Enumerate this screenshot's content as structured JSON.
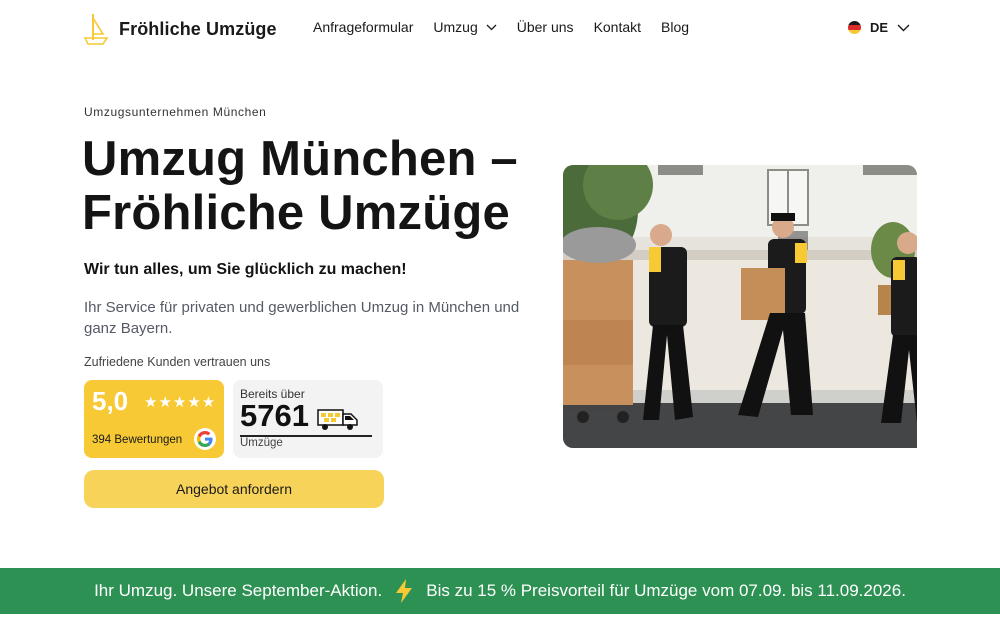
{
  "header": {
    "brand": "Fröhliche Umzüge",
    "nav": [
      {
        "label": "Anfrageformular",
        "has_dropdown": false
      },
      {
        "label": "Umzug",
        "has_dropdown": true
      },
      {
        "label": "Über uns",
        "has_dropdown": false
      },
      {
        "label": "Kontakt",
        "has_dropdown": false
      },
      {
        "label": "Blog",
        "has_dropdown": false
      }
    ],
    "language": "DE"
  },
  "hero": {
    "eyebrow": "Umzugsunternehmen München",
    "title_line1": "Umzug München –",
    "title_line2": "Fröhliche Umzüge",
    "tagline": "Wir tun alles, um Sie glücklich zu machen!",
    "description": "Ihr Service für privaten und gewerblichen Umzug in München und ganz Bayern.",
    "trust_label": "Zufriedene Kunden vertrauen uns",
    "rating": {
      "score": "5,0",
      "stars": 5,
      "reviews": "394 Bewertungen",
      "icon": "google-icon"
    },
    "moves": {
      "label": "Bereits über",
      "count": "5761",
      "unit": "Umzüge",
      "icon": "truck-icon"
    },
    "cta": "Angebot anfordern"
  },
  "promo": {
    "text_left": "Ihr Umzug. Unsere September-Aktion.",
    "icon": "lightning-icon",
    "text_right": "Bis zu 15 % Preisvorteil für Umzüge vom 07.09. bis 11.09.2026."
  },
  "colors": {
    "accent_yellow": "#f6c935",
    "cta_yellow": "#f7d35a",
    "promo_green": "#2e9154",
    "text_dark": "#141414"
  }
}
